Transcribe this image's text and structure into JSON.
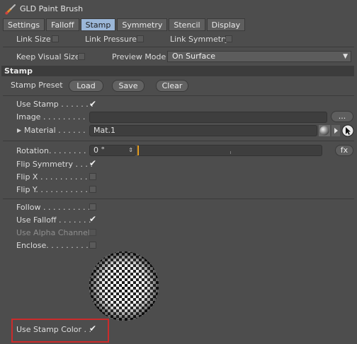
{
  "window": {
    "title": "GLD Paint Brush"
  },
  "tabs": [
    "Settings",
    "Falloff",
    "Stamp",
    "Symmetry",
    "Stencil",
    "Display"
  ],
  "links": {
    "link_size": "Link Size",
    "link_pressure": "Link Pressure",
    "link_symmetry": "Link Symmetry"
  },
  "visual": {
    "keep_visual_size": "Keep Visual Size",
    "preview_mode_label": "Preview Mode",
    "preview_mode_value": "On Surface"
  },
  "stamp_section": {
    "header": "Stamp",
    "preset_label": "Stamp Preset",
    "load": "Load",
    "save": "Save",
    "clear": "Clear",
    "use_stamp": "Use Stamp . . . . . . .",
    "image": "Image . . . . . . . . .",
    "image_browse": "...",
    "material": "Material . . . . . .",
    "material_value": "Mat.1",
    "rotation": "Rotation. . . . . . . . .",
    "rotation_value": "0 °",
    "fx": "fx",
    "flip_symmetry": "Flip Symmetry . . . .",
    "flip_x": "Flip X . . . . . . . . . .",
    "flip_y": "Flip Y. . . . . . . . . . .",
    "follow": "Follow . . . . . . . . . .",
    "use_falloff": "Use Falloff . . . . . . .",
    "use_alpha_channel": "Use Alpha Channel",
    "enclose": "Enclose. . . . . . . . . .",
    "use_stamp_color": "Use Stamp Color . ."
  },
  "checkbox_states": {
    "use_stamp": true,
    "flip_symmetry": true,
    "use_falloff": true,
    "use_stamp_color": true,
    "link_size": false,
    "link_pressure": false,
    "link_symmetry": false,
    "keep_visual_size": false,
    "flip_x": false,
    "flip_y": false,
    "follow": false,
    "use_alpha_channel": false,
    "enclose": false
  },
  "colors": {
    "active_tab": "#9bb7d8",
    "highlight": "#cc2b2b",
    "rotation_slider": "#e8a020"
  }
}
